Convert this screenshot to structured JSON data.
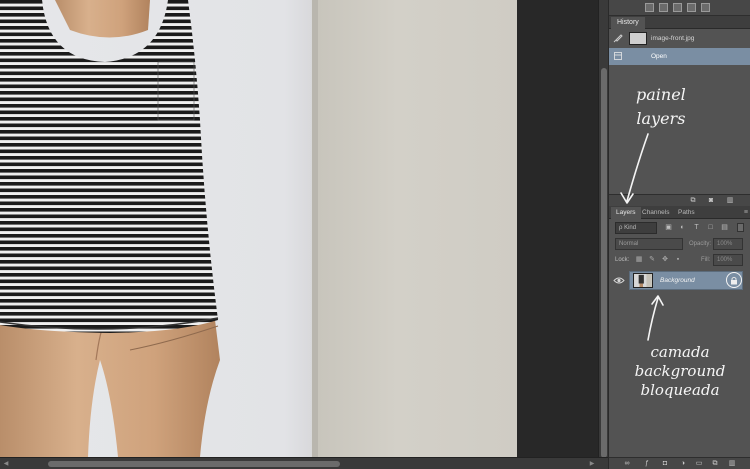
{
  "history": {
    "tab_label": "History",
    "snapshot_name": "image-front.jpg",
    "open_step": "Open"
  },
  "layers": {
    "tabs": [
      "Layers",
      "Channels",
      "Paths"
    ],
    "panel_menu_icon": "panel-menu-icon",
    "filter_kind": "ρ Kind",
    "blend_mode": "Normal",
    "opacity_label": "Opacity:",
    "opacity_value": "100%",
    "lock_label": "Lock:",
    "fill_label": "Fill:",
    "fill_value": "100%",
    "layer_name": "Background"
  },
  "annotations": {
    "panel_line1": "painel",
    "panel_line2": "layers",
    "layer_line1": "camada",
    "layer_line2": "background",
    "layer_line3": "bloqueada"
  },
  "colors": {
    "panel_bg": "#535353",
    "selection": "#7a8ea3",
    "workspace": "#282828"
  }
}
